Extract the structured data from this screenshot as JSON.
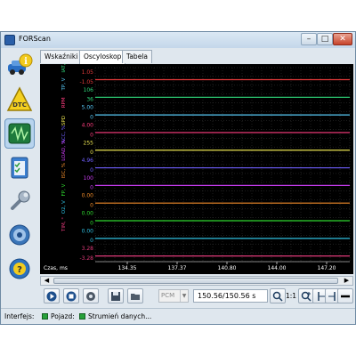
{
  "window": {
    "title": "FORScan",
    "min_glyph": "–",
    "max_glyph": "□",
    "close_glyph": "✕"
  },
  "sidebar": {
    "items": [
      {
        "name": "vehicle-info-icon",
        "active": false
      },
      {
        "name": "dtc-icon",
        "label": "DTC",
        "active": false
      },
      {
        "name": "oscilloscope-icon",
        "active": true
      },
      {
        "name": "checklist-icon",
        "active": false
      },
      {
        "name": "wrench-icon",
        "active": false
      },
      {
        "name": "settings-gear-icon",
        "active": false
      },
      {
        "name": "help-icon",
        "active": false
      }
    ]
  },
  "tabs": [
    {
      "label": "Wskaźniki",
      "active": false
    },
    {
      "label": "Oscyloskop",
      "active": true
    },
    {
      "label": "Tabela",
      "active": false
    }
  ],
  "scope": {
    "colors": {
      "background": "#000000",
      "grid": "#3a3a3a",
      "axis": "#b0b0b0"
    },
    "channels": [
      {
        "label": "ECT, °C",
        "color": "#e23a3a",
        "max": "1.05",
        "min": "-1.05"
      },
      {
        "label": "IAT, °C",
        "color": "#2fd67a",
        "max": "106",
        "min": "36"
      },
      {
        "label": "TP, V",
        "color": "#57c7f5",
        "max": "5.00",
        "min": "0"
      },
      {
        "label": "RPM",
        "color": "#ff3d7f",
        "max": "4.00",
        "min": "0"
      },
      {
        "label": "SPD",
        "color": "#e8e050",
        "max": "255",
        "min": "0"
      },
      {
        "label": "ACC, %",
        "color": "#7060ff",
        "max": "4.96",
        "min": "0"
      },
      {
        "label": "LOAD, %",
        "color": "#c83cf0",
        "max": "100",
        "min": "0"
      },
      {
        "label": "ISC, %",
        "color": "#f08c2a",
        "max": "0.00",
        "min": "0"
      },
      {
        "label": "FP, V",
        "color": "#2fd62f",
        "max": "0.00",
        "min": "0"
      },
      {
        "label": "O2, V",
        "color": "#2fbfe0",
        "max": "0.00",
        "min": "0"
      },
      {
        "label": "TIM, °",
        "color": "#e03a7a",
        "max": "3.28",
        "min": "-3.28"
      }
    ],
    "x_axis": {
      "label": "Czas, ms",
      "ticks": [
        "134.35",
        "137.37",
        "140.80",
        "144.00",
        "147.20"
      ]
    }
  },
  "scroll": {
    "left_glyph": "◀",
    "right_glyph": "▶"
  },
  "toolbar": {
    "combo_value": "PCM",
    "time_value": "150.56/150.56 s",
    "scale_label": "1:1",
    "icons": [
      "play-icon",
      "stop-icon",
      "settings-icon",
      "save-icon",
      "open-folder-icon",
      "zoom-icon",
      "zoom-in-icon",
      "cursor-left-icon",
      "cursor-right-icon",
      "line-style-icon"
    ]
  },
  "status": {
    "interface_label": "Interfejs:",
    "vehicle_label": "Pojazd:",
    "stream_label": "Strumień danych..."
  }
}
